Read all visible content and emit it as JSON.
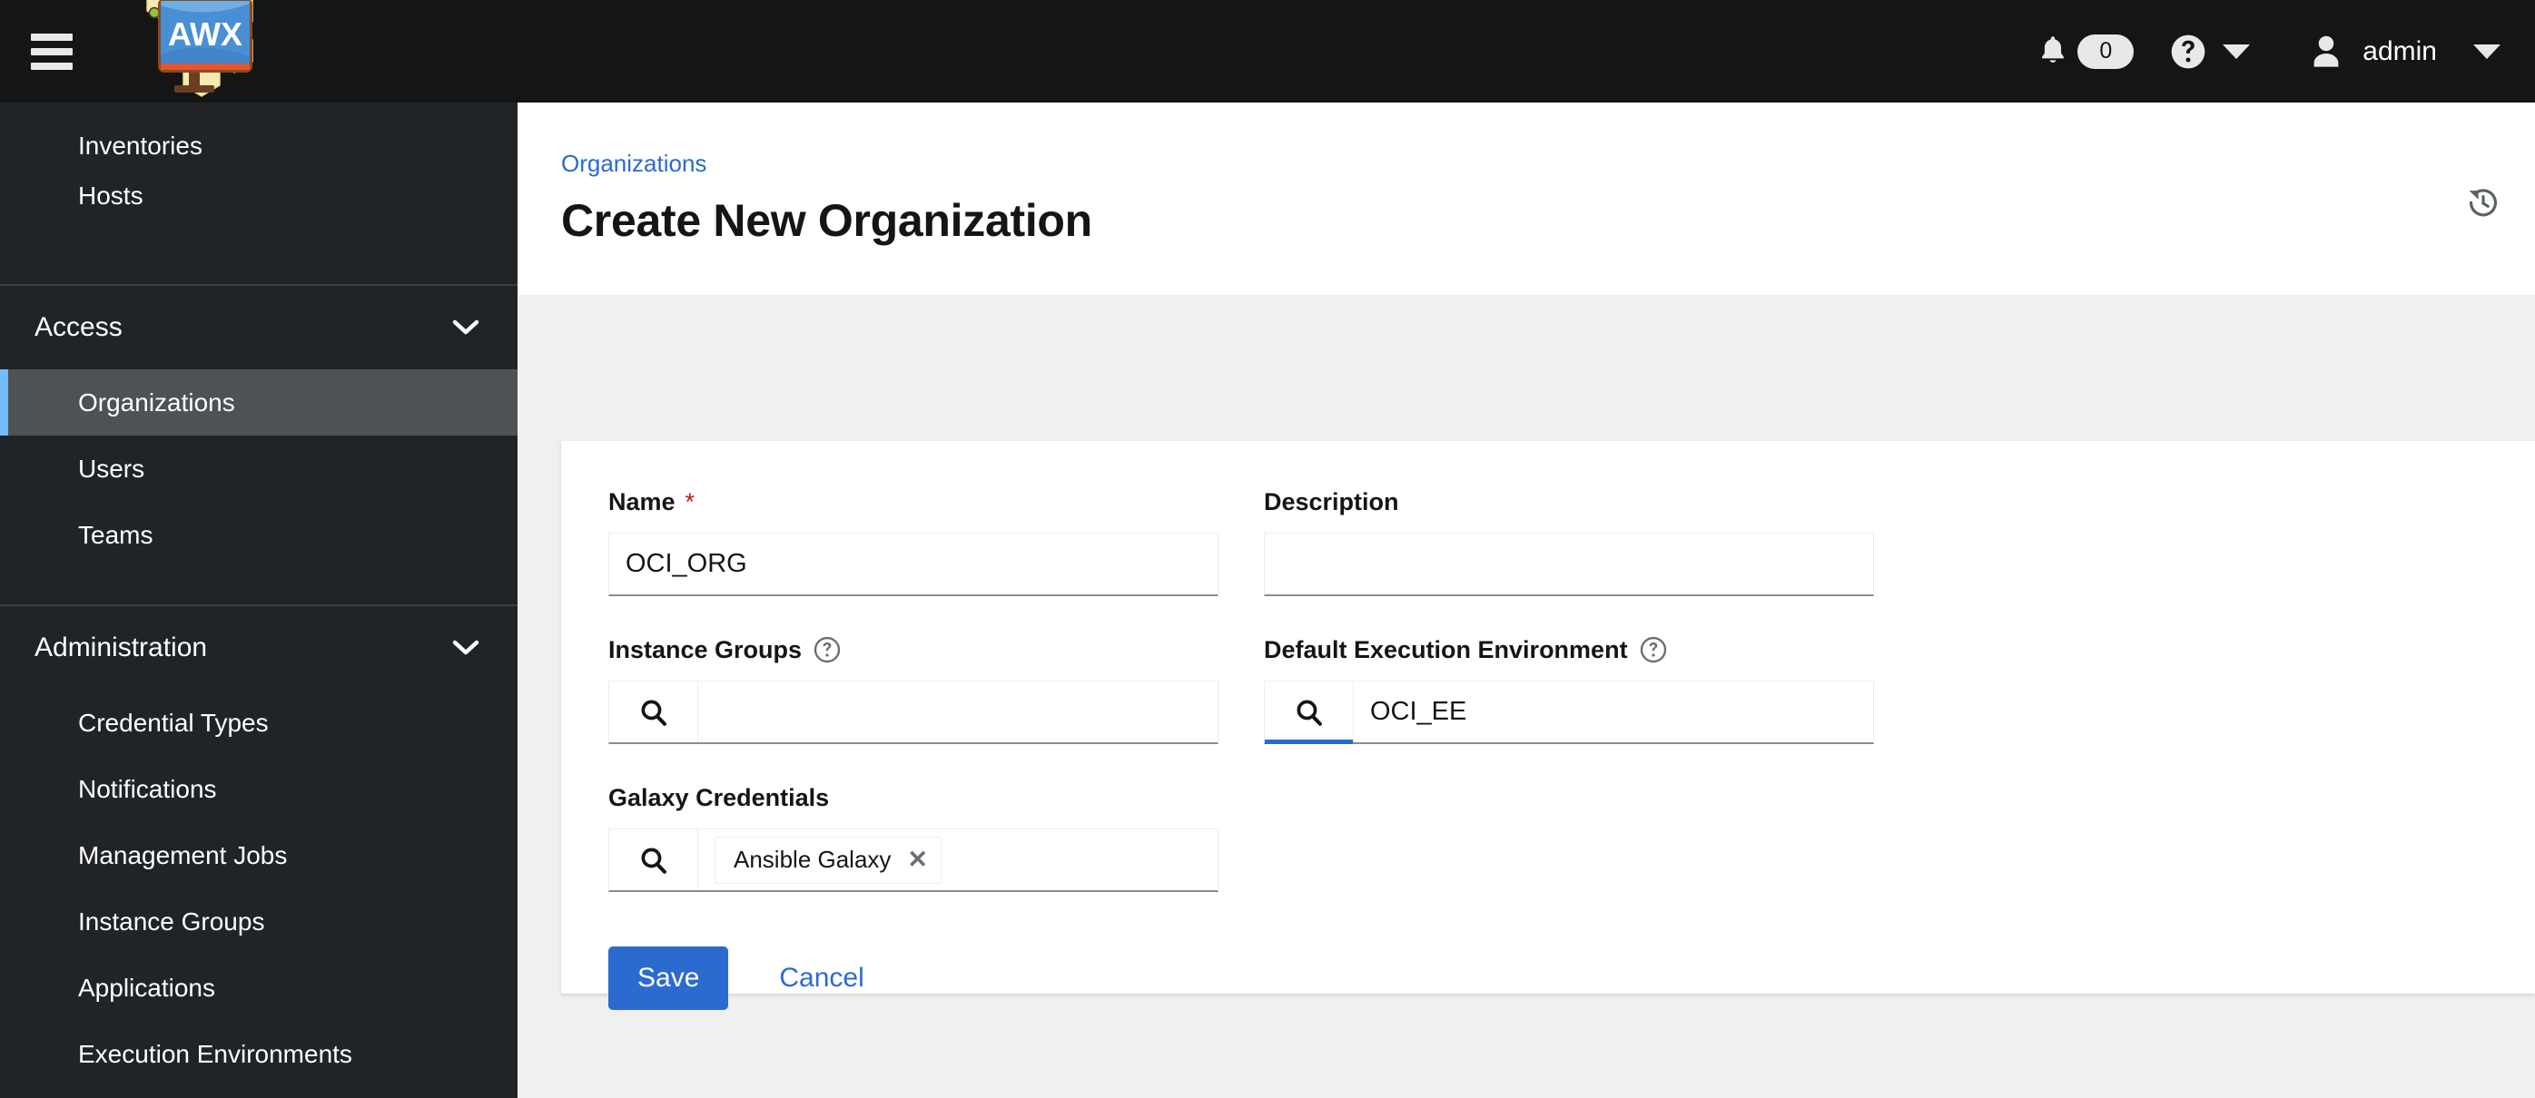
{
  "masthead": {
    "nav_toggle_label": "Global navigation",
    "brand_text": "AWX",
    "notifications_count": "0",
    "username": "admin"
  },
  "sidebar": {
    "top_items": [
      {
        "label": "Inventories",
        "active": false
      },
      {
        "label": "Hosts",
        "active": false
      }
    ],
    "sections": [
      {
        "title": "Access",
        "expanded": true,
        "items": [
          {
            "label": "Organizations",
            "active": true
          },
          {
            "label": "Users",
            "active": false
          },
          {
            "label": "Teams",
            "active": false
          }
        ]
      },
      {
        "title": "Administration",
        "expanded": true,
        "items": [
          {
            "label": "Credential Types",
            "active": false
          },
          {
            "label": "Notifications",
            "active": false
          },
          {
            "label": "Management Jobs",
            "active": false
          },
          {
            "label": "Instance Groups",
            "active": false
          },
          {
            "label": "Applications",
            "active": false
          },
          {
            "label": "Execution Environments",
            "active": false
          }
        ]
      }
    ]
  },
  "page": {
    "breadcrumb": "Organizations",
    "title": "Create New Organization",
    "history_icon": "history-icon"
  },
  "form": {
    "name": {
      "label": "Name",
      "required_marker": "*",
      "value": "OCI_ORG",
      "placeholder": ""
    },
    "description": {
      "label": "Description",
      "value": "",
      "placeholder": ""
    },
    "instance_groups": {
      "label": "Instance Groups",
      "help_icon": "question-circle-icon",
      "search_icon": "search-icon",
      "value": "",
      "placeholder": ""
    },
    "default_execution_environment": {
      "label": "Default Execution Environment",
      "help_icon": "question-circle-icon",
      "search_icon": "search-icon",
      "value": "OCI_EE",
      "placeholder": ""
    },
    "galaxy_credentials": {
      "label": "Galaxy Credentials",
      "search_icon": "search-icon",
      "chips": [
        {
          "label": "Ansible Galaxy",
          "remove_label": "✕"
        }
      ],
      "placeholder": ""
    }
  },
  "actions": {
    "save_label": "Save",
    "cancel_label": "Cancel"
  },
  "colors": {
    "masthead_bg": "#151515",
    "sidebar_bg": "#212427",
    "sidebar_active_bg": "#4f5255",
    "sidebar_active_border": "#73bcf7",
    "accent_blue": "#2b6bd0",
    "link_blue": "#2b6bd0",
    "required_red": "#c9190b",
    "page_bg": "#f0f0f0"
  }
}
